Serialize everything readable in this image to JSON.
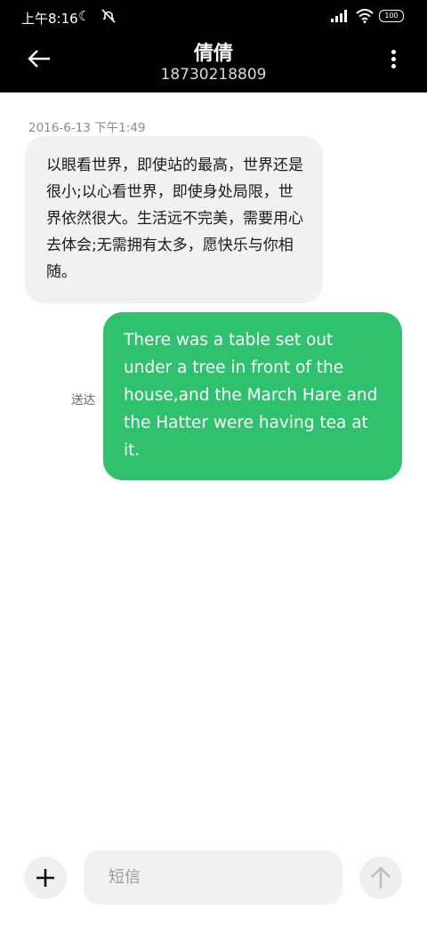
{
  "status_bar": {
    "time": "上午8:16",
    "battery": "100"
  },
  "header": {
    "contact_name": "倩倩",
    "phone_number": "18730218809"
  },
  "conversation": {
    "timestamp": "2016-6-13 下午1:49",
    "incoming_message": "以眼看世界，即使站的最高，世界还是很小;以心看世界，即使身处局限，世界依然很大。生活远不完美，需要用心去体会;无需拥有太多，愿快乐与你相随。",
    "outgoing_message": "There was a table set out under a tree in front of the house,and the March Hare and the Hatter were having tea at it.",
    "delivery_status": "送达"
  },
  "composer": {
    "placeholder": "短信"
  },
  "colors": {
    "header_bg": "#000000",
    "outgoing_bubble": "#2fc16d",
    "incoming_bubble": "#f1f1f1"
  }
}
